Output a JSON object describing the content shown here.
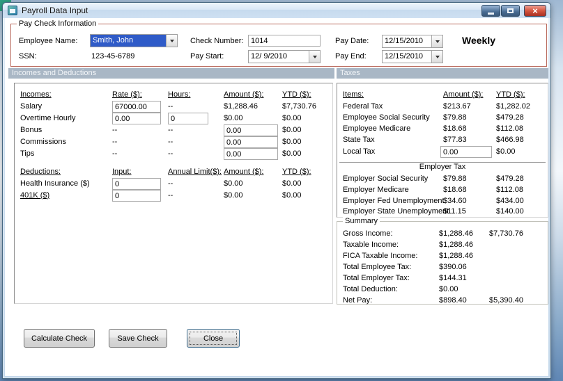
{
  "window": {
    "title": "Payroll Data Input"
  },
  "icons": {
    "close": "×"
  },
  "colors": {
    "section_header_bg": "#a9b7c5",
    "paycheck_border": "#b96a5d",
    "selection_bg": "#2f5bc8",
    "close_button_bg": "#c0392b"
  },
  "paycheck": {
    "legend": "Pay Check Information",
    "employee_name_label": "Employee Name:",
    "employee_name": "Smith, John",
    "ssn_label": "SSN:",
    "ssn": "123-45-6789",
    "check_number_label": "Check Number:",
    "check_number": "1014",
    "pay_start_label": "Pay Start:",
    "pay_start": "12/ 9/2010",
    "pay_date_label": "Pay Date:",
    "pay_date": "12/15/2010",
    "pay_end_label": "Pay End:",
    "pay_end": "12/15/2010",
    "frequency": "Weekly"
  },
  "sections": {
    "incomes_header": "Incomes and Deductions",
    "taxes_header": "Taxes"
  },
  "incomes": {
    "headers": {
      "c1": "Incomes:",
      "c2": "Rate ($):",
      "c3": "Hours:",
      "c4": "Amount ($):",
      "c5": "YTD ($):"
    },
    "rows": [
      {
        "label": "Salary",
        "rate": "67000.00",
        "hours": "--",
        "amount": "$1,288.46",
        "ytd": "$7,730.76"
      },
      {
        "label": "Overtime Hourly",
        "rate": "0.00",
        "hours": "0",
        "amount": "$0.00",
        "ytd": "$0.00"
      },
      {
        "label": "Bonus",
        "rate": "--",
        "hours": "--",
        "amount": "0.00",
        "ytd": "$0.00"
      },
      {
        "label": "Commissions",
        "rate": "--",
        "hours": "--",
        "amount": "0.00",
        "ytd": "$0.00"
      },
      {
        "label": "Tips",
        "rate": "--",
        "hours": "--",
        "amount": "0.00",
        "ytd": "$0.00"
      }
    ]
  },
  "deductions": {
    "headers": {
      "c1": "Deductions:",
      "c2": "Input:",
      "c3": "Annual Limit($):",
      "c4": "Amount ($):",
      "c5": "YTD ($):"
    },
    "rows": [
      {
        "label": "Health Insurance  ($)",
        "input": "0",
        "limit": "--",
        "amount": "$0.00",
        "ytd": "$0.00"
      },
      {
        "label": "401K  ($)",
        "input": "0",
        "limit": "--",
        "amount": "$0.00",
        "ytd": "$0.00"
      }
    ]
  },
  "taxes": {
    "headers": {
      "c1": "Items:",
      "c2": "Amount ($):",
      "c3": "YTD ($):"
    },
    "employee_rows": [
      {
        "label": "Federal Tax",
        "amount": "$213.67",
        "ytd": "$1,282.02"
      },
      {
        "label": "Employee Social Security",
        "amount": "$79.88",
        "ytd": "$479.28"
      },
      {
        "label": "Employee Medicare",
        "amount": "$18.68",
        "ytd": "$112.08"
      },
      {
        "label": "State Tax",
        "amount": "$77.83",
        "ytd": "$466.98"
      }
    ],
    "local_tax": {
      "label": "Local Tax",
      "amount": "0.00",
      "ytd": "$0.00"
    },
    "employer_legend": "Employer Tax",
    "employer_rows": [
      {
        "label": "Employer Social Security",
        "amount": "$79.88",
        "ytd": "$479.28"
      },
      {
        "label": "Employer Medicare",
        "amount": "$18.68",
        "ytd": "$112.08"
      },
      {
        "label": "Employer Fed Unemployment",
        "amount": "$34.60",
        "ytd": "$434.00"
      },
      {
        "label": "Employer State Unemployment",
        "amount": "$11.15",
        "ytd": "$140.00"
      }
    ]
  },
  "summary": {
    "legend": "Summary",
    "rows": [
      {
        "label": "Gross Income:",
        "amount": "$1,288.46",
        "ytd": "$7,730.76"
      },
      {
        "label": "Taxable Income:",
        "amount": "$1,288.46",
        "ytd": ""
      },
      {
        "label": "FICA Taxable Income:",
        "amount": "$1,288.46",
        "ytd": ""
      },
      {
        "label": "Total Employee Tax:",
        "amount": "$390.06",
        "ytd": ""
      },
      {
        "label": "Total Employer Tax:",
        "amount": "$144.31",
        "ytd": ""
      },
      {
        "label": "Total Deduction:",
        "amount": "$0.00",
        "ytd": ""
      },
      {
        "label": "Net Pay:",
        "amount": "$898.40",
        "ytd": "$5,390.40"
      }
    ]
  },
  "buttons": {
    "calculate": "Calculate Check",
    "save": "Save Check",
    "close": "Close"
  }
}
